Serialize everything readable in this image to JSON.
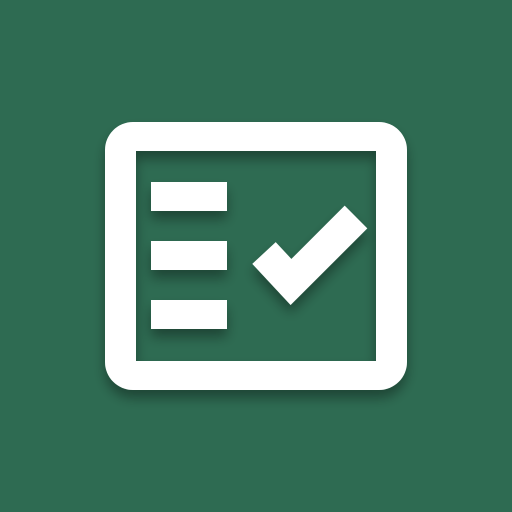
{
  "icon": {
    "name": "checklist-icon",
    "colors": {
      "background": "#2e6b52",
      "foreground": "#ffffff",
      "shadow": "rgba(0,0,0,0.28)"
    }
  }
}
